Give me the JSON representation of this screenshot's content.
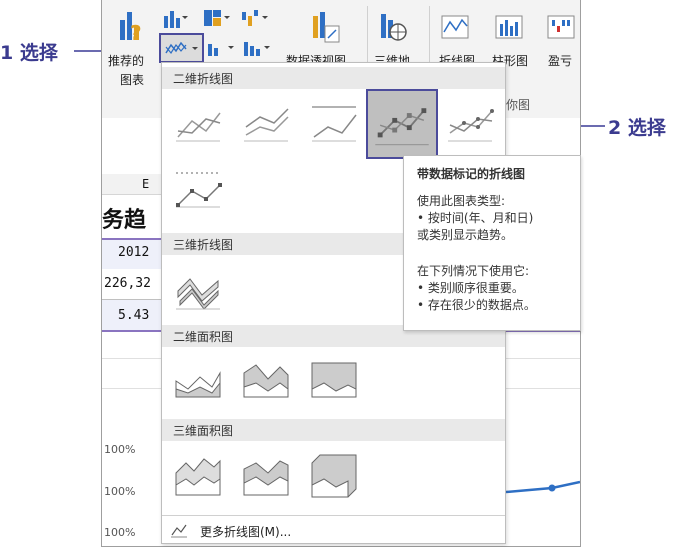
{
  "callouts": {
    "step1": "1 选择",
    "step2": "2 选择"
  },
  "ribbon": {
    "recommended_label_1": "推荐的",
    "recommended_label_2": "图表",
    "pivot_chart_label": "数据透视图",
    "map_label": "三维地",
    "line_spark_label": "折线图",
    "column_spark_label": "柱形图",
    "winloss_spark_label": "盈亏",
    "group_label": "你图"
  },
  "sheet": {
    "col_header": "E",
    "title_partial": "务趋",
    "cells": [
      "2012",
      "226,32",
      "5.43"
    ],
    "pct_labels": [
      "100%",
      "100%",
      "100%"
    ]
  },
  "dropdown": {
    "sections": [
      "二维折线图",
      "三维折线图",
      "二维面积图",
      "三维面积图"
    ],
    "more_link": "更多折线图(M)..."
  },
  "tooltip": {
    "title": "带数据标记的折线图",
    "lines": [
      "使用此图表类型:",
      "• 按时间(年、月和日)",
      "或类别显示趋势。",
      "",
      "在下列情况下使用它:",
      "• 类别顺序很重要。",
      "• 存在很少的数据点。"
    ]
  },
  "colors": {
    "callout": "#3b3b8f",
    "highlight_border": "#4b4b9b",
    "accent_blue": "#2e6fc4",
    "selected_bg": "#bfbfbf"
  }
}
